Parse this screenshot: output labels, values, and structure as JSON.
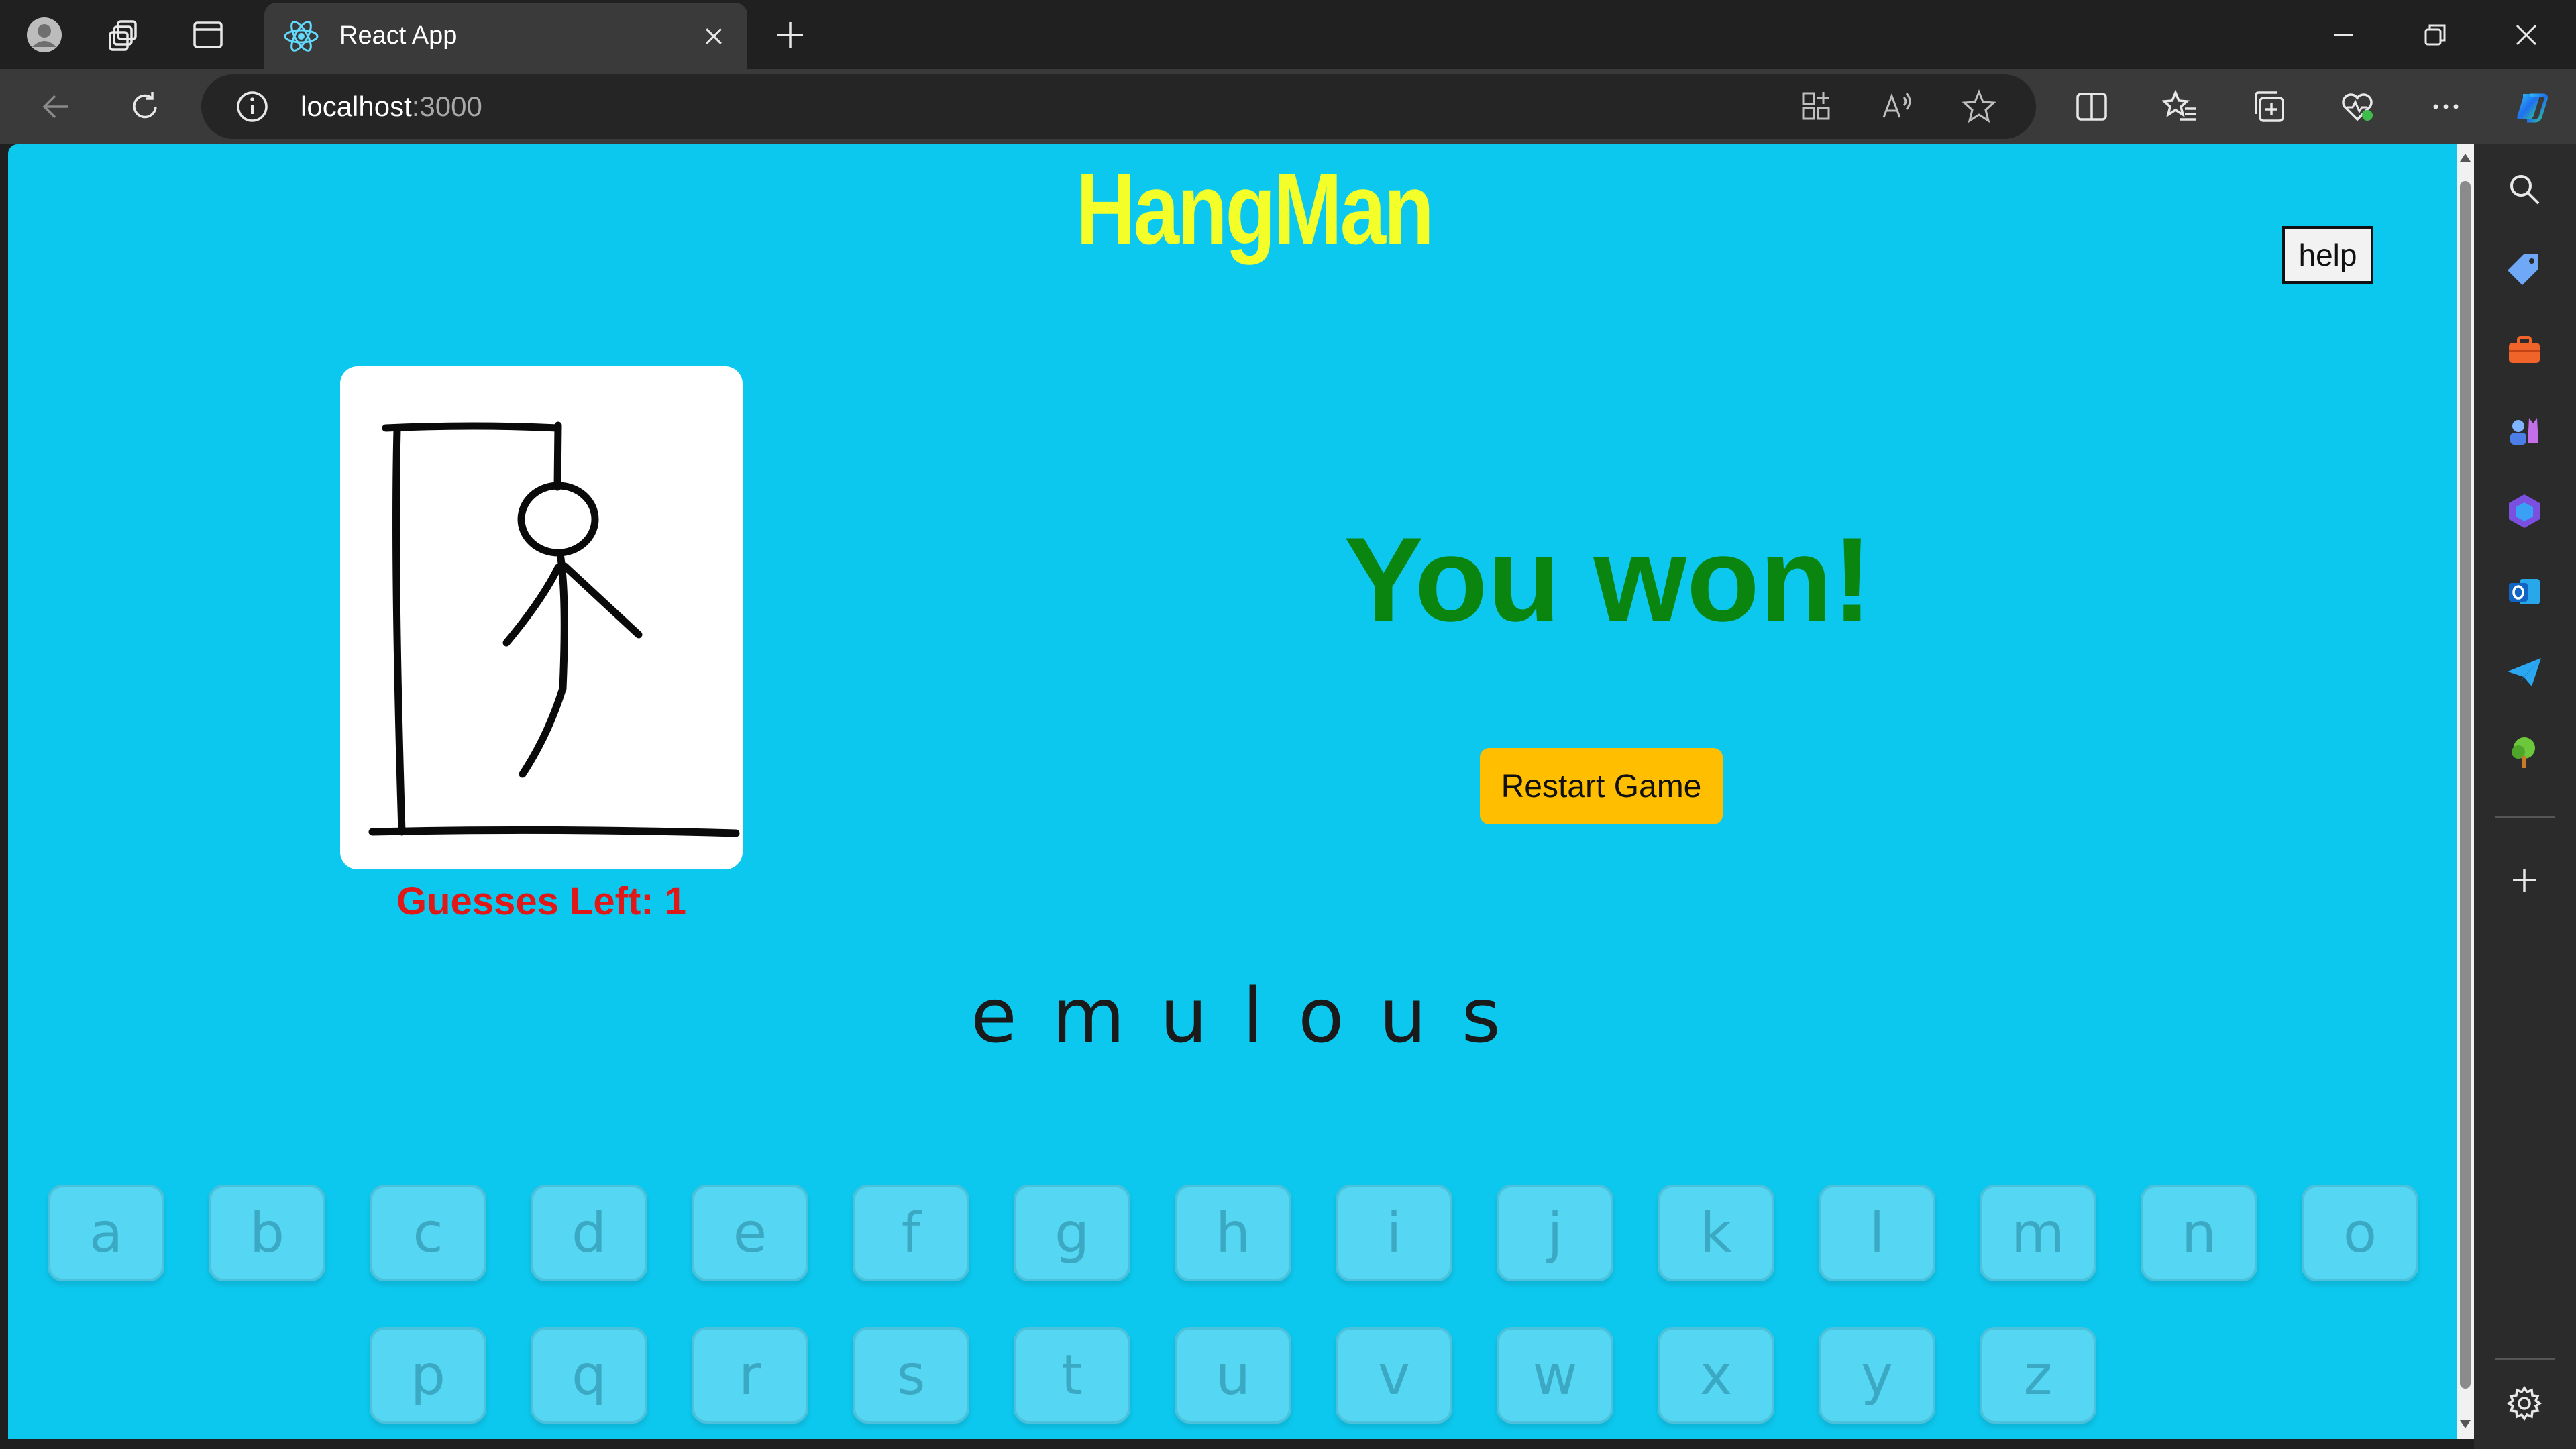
{
  "browser": {
    "tab_title": "React App",
    "url_host": "localhost",
    "url_port": ":3000"
  },
  "page": {
    "title": "HangMan",
    "help_label": "help",
    "guesses_left": "Guesses Left: 1",
    "result_text": "You won!",
    "restart_label": "Restart Game",
    "word_letters": [
      "e",
      "m",
      "u",
      "l",
      "o",
      "u",
      "s"
    ],
    "keyboard_row1": [
      "a",
      "b",
      "c",
      "d",
      "e",
      "f",
      "g",
      "h",
      "i",
      "j",
      "k",
      "l",
      "m",
      "n",
      "o"
    ],
    "keyboard_row2": [
      "p",
      "q",
      "r",
      "s",
      "t",
      "u",
      "v",
      "w",
      "x",
      "y",
      "z"
    ]
  },
  "colors": {
    "background": "#0dc8ee",
    "title": "#f4ff2a",
    "guesses": "#e01818",
    "result": "#0a850f",
    "restart_button": "#ffbf00",
    "disabled_key": "#55d7f3"
  },
  "icons": {
    "sidebar": [
      "search-icon",
      "tag-icon",
      "toolbox-icon",
      "games-icon",
      "copilot-icon",
      "outlook-icon",
      "send-icon",
      "tree-icon",
      "add-icon",
      "settings-icon"
    ]
  }
}
